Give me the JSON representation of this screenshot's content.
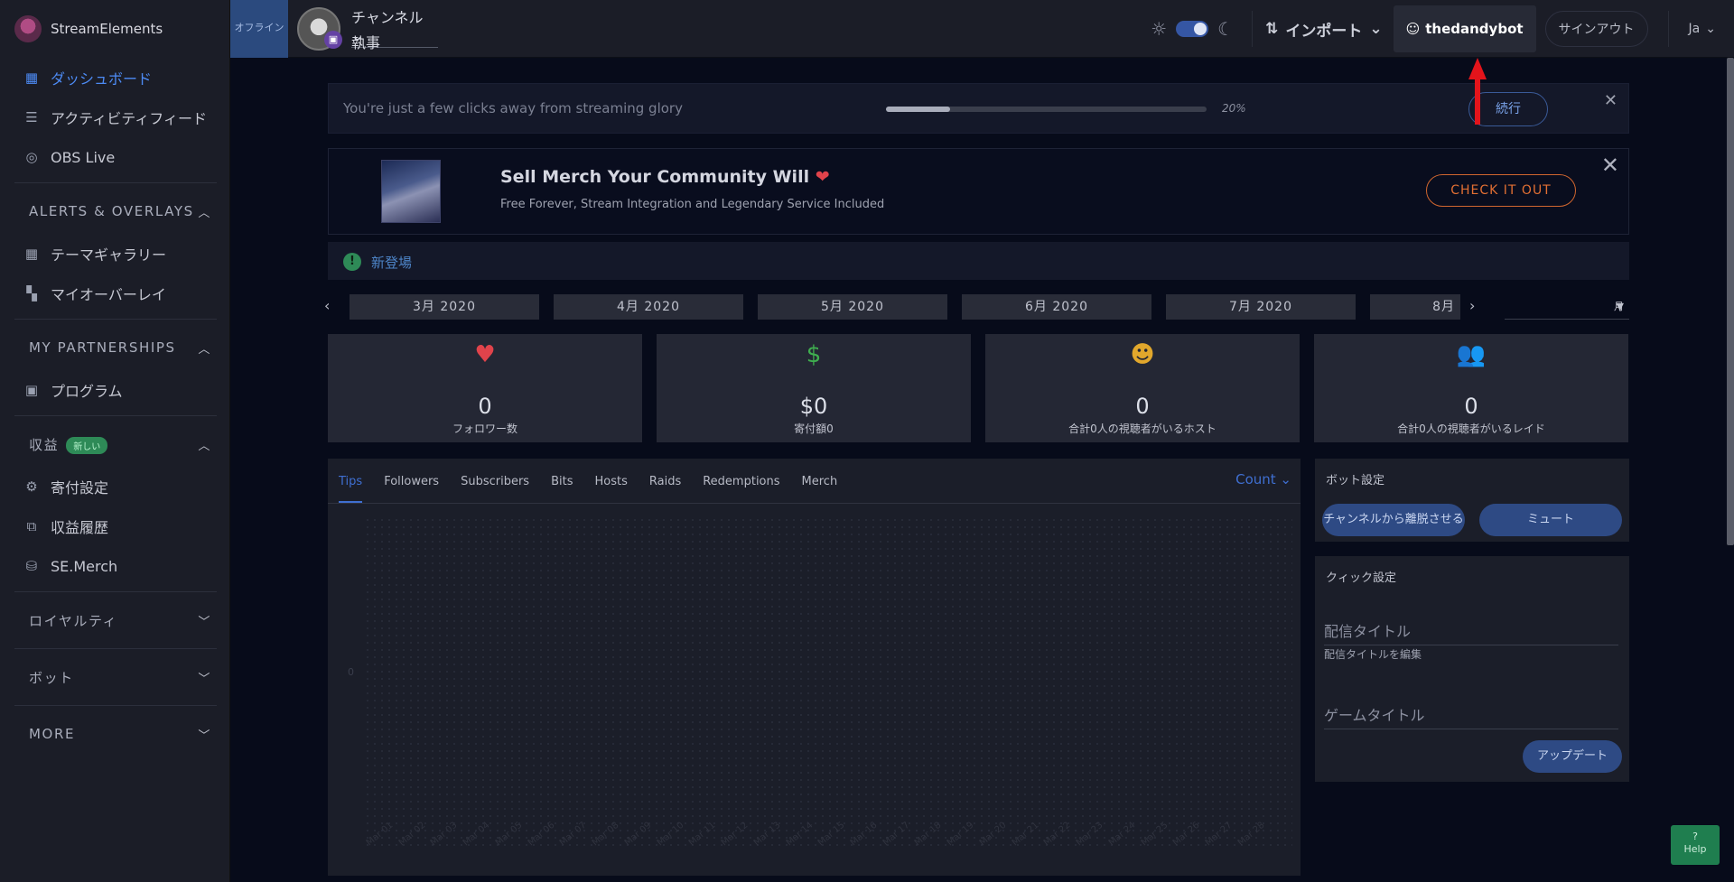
{
  "brand": {
    "name_bold": "Stream",
    "name_rest": "Elements"
  },
  "sidebar": {
    "items_top": [
      {
        "label": "ダッシュボード",
        "icon": "dashboard-icon"
      },
      {
        "label": "アクティビティフィード",
        "icon": "list-icon"
      },
      {
        "label": "OBS Live",
        "icon": "obs-icon"
      }
    ],
    "alerts_section": "ALERTS & OVERLAYS",
    "alerts_items": [
      {
        "label": "テーマギャラリー",
        "icon": "grid-icon"
      },
      {
        "label": "マイオーバーレイ",
        "icon": "overlay-icon"
      }
    ],
    "partnerships_section": "MY PARTNERSHIPS",
    "partnerships_items": [
      {
        "label": "プログラム",
        "icon": "program-icon"
      }
    ],
    "revenue_section": "収益",
    "revenue_badge": "新しい",
    "revenue_items": [
      {
        "label": "寄付設定",
        "icon": "gear-icon"
      },
      {
        "label": "収益履歴",
        "icon": "history-icon"
      },
      {
        "label": "SE.Merch",
        "icon": "basket-icon"
      }
    ],
    "loyalty_section": "ロイヤルティ",
    "bot_section": "ボット",
    "more_section": "MORE"
  },
  "topbar": {
    "offline_label": "オフライン",
    "channel_select": "チャンネル",
    "channel_name": "執事",
    "import_label": "インポート",
    "username": "thedandybot",
    "signout": "サインアウト",
    "lang": "Ja"
  },
  "progress": {
    "text": "You're just a few clicks away from streaming glory",
    "percent_label": "20%",
    "percent": 20,
    "continue_label": "続行"
  },
  "merch": {
    "title": "Sell Merch Your Community Will",
    "subtitle": "Free Forever, Stream Integration and Legendary Service Included",
    "cta": "CHECK IT OUT"
  },
  "whats_new": "新登場",
  "months": [
    "3月 2020",
    "4月 2020",
    "5月 2020",
    "6月 2020",
    "7月 2020",
    "8月"
  ],
  "period": "月",
  "stats": [
    {
      "value": "0",
      "label": "フォロワー数",
      "icon": "heart-icon",
      "color": "#e0434b"
    },
    {
      "value": "$0",
      "label": "寄付額0",
      "icon": "dollar-icon",
      "color": "#3fae4f"
    },
    {
      "value": "0",
      "label": "合計0人の視聴者がいるホスト",
      "icon": "user-circle-icon",
      "color": "#e1a72c"
    },
    {
      "value": "0",
      "label": "合計0人の視聴者がいるレイド",
      "icon": "group-icon",
      "color": "#5b9bd5"
    }
  ],
  "chart": {
    "tabs": [
      "Tips",
      "Followers",
      "Subscribers",
      "Bits",
      "Hosts",
      "Raids",
      "Redemptions",
      "Merch"
    ],
    "count_label": "Count",
    "zero": "0",
    "x_labels": [
      "Mar 01",
      "Mar 02",
      "Mar 03",
      "Mar 04",
      "Mar 05",
      "Mar 06",
      "Mar 07",
      "Mar 08",
      "Mar 09",
      "Mar 10",
      "Mar 11",
      "Mar 12",
      "Mar 13",
      "Mar 14",
      "Mar 15",
      "Mar 16",
      "Mar 17",
      "Mar 18",
      "Mar 19",
      "Mar 20",
      "Mar 21",
      "Mar 22",
      "Mar 23",
      "Mar 24",
      "Mar 25",
      "Mar 26",
      "Mar 27",
      "Mar 28"
    ]
  },
  "bot_settings": {
    "title": "ボット設定",
    "leave_label": "チャンネルから離脱させる",
    "mute_label": "ミュート"
  },
  "quick_settings": {
    "title": "クィック設定",
    "stream_title_label": "配信タイトル",
    "stream_title_hint": "配信タイトルを編集",
    "game_title_label": "ゲームタイトル",
    "update_label": "アップデート"
  },
  "help_label": "Help"
}
